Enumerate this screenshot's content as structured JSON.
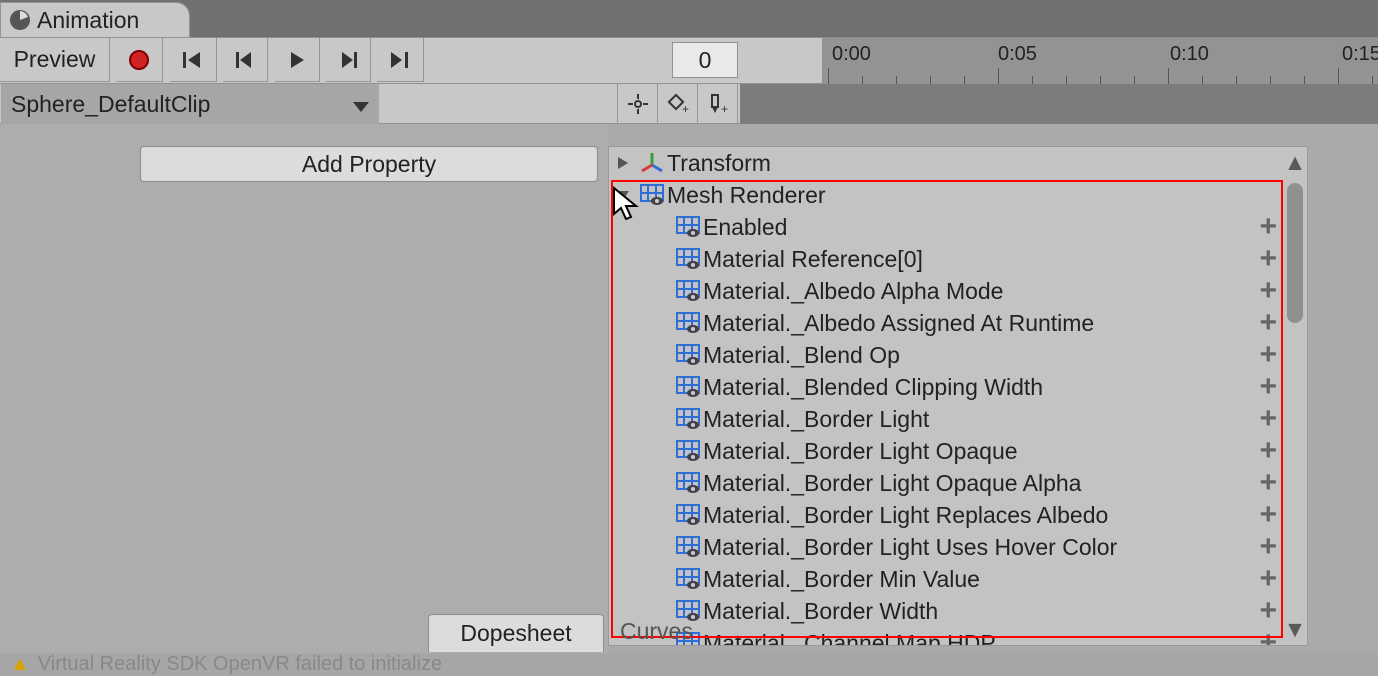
{
  "tab": {
    "title": "Animation"
  },
  "transport": {
    "preview": "Preview",
    "frame": "0"
  },
  "clip": {
    "name": "Sphere_DefaultClip"
  },
  "ruler": {
    "marks": [
      "0:00",
      "0:05",
      "0:10",
      "0:15"
    ]
  },
  "addProperty": "Add Property",
  "popup": {
    "transform": "Transform",
    "meshRenderer": "Mesh Renderer",
    "properties": [
      "Enabled",
      "Material Reference[0]",
      "Material._Albedo Alpha Mode",
      "Material._Albedo Assigned At Runtime",
      "Material._Blend Op",
      "Material._Blended Clipping Width",
      "Material._Border Light",
      "Material._Border Light Opaque",
      "Material._Border Light Opaque Alpha",
      "Material._Border Light Replaces Albedo",
      "Material._Border Light Uses Hover Color",
      "Material._Border Min Value",
      "Material._Border Width",
      "Material._Channel Map HDP"
    ]
  },
  "bottom": {
    "dopesheet": "Dopesheet",
    "curves": "Curves"
  },
  "status": "Virtual Reality SDK OpenVR failed to initialize"
}
